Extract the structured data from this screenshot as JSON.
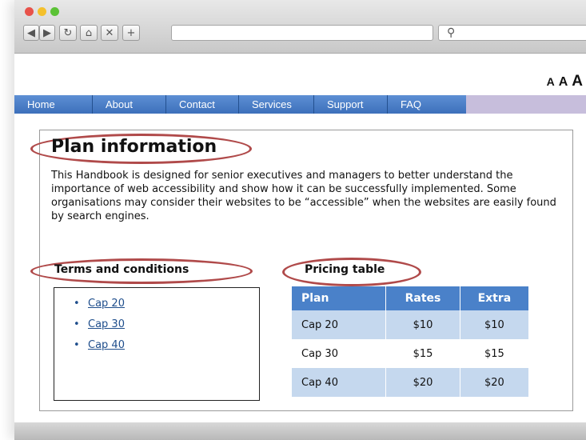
{
  "toolbar": {
    "back_icon": "◀",
    "forward_icon": "▶",
    "reload_icon": "↻",
    "home_icon": "⌂",
    "stop_icon": "✕",
    "new_tab_icon": "+",
    "search_icon": "⚲"
  },
  "text_size": [
    "A",
    "A",
    "A"
  ],
  "nav": [
    "Home",
    "About",
    "Contact",
    "Services",
    "Support",
    "FAQ"
  ],
  "content": {
    "title": "Plan information",
    "paragraph": "This Handbook is designed for senior executives and managers to better understand the importance of web accessibility and show how it can be successfully implemented. Some organisations may consider their websites to be “accessible” when the websites are easily found by search engines."
  },
  "terms": {
    "heading": "Terms and conditions",
    "links": [
      "Cap 20",
      "Cap 30",
      "Cap 40"
    ]
  },
  "pricing": {
    "heading": "Pricing table",
    "columns": [
      "Plan",
      "Rates",
      "Extra"
    ],
    "rows": [
      [
        "Cap 20",
        "$10",
        "$10"
      ],
      [
        "Cap 30",
        "$15",
        "$15"
      ],
      [
        "Cap 40",
        "$20",
        "$20"
      ]
    ]
  },
  "colors": {
    "nav_blue": "#4a81c9",
    "highlight_oval": "#b04a4a",
    "table_shade": "#c5d8ee",
    "link": "#1f4e8c"
  }
}
